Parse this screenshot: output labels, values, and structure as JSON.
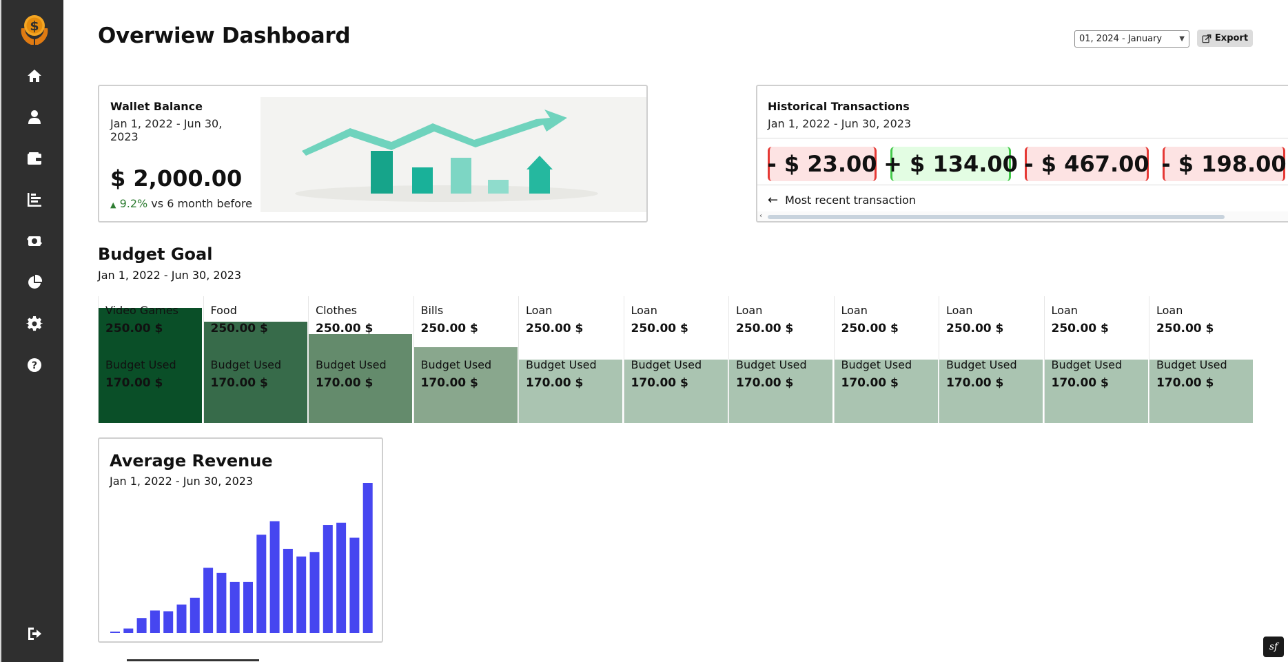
{
  "sidebar": {
    "items": [
      {
        "icon": "home-icon"
      },
      {
        "icon": "user-icon"
      },
      {
        "icon": "wallet-icon"
      },
      {
        "icon": "bar-chart-icon"
      },
      {
        "icon": "money-exchange-icon"
      },
      {
        "icon": "pie-chart-icon"
      },
      {
        "icon": "gear-icon"
      },
      {
        "icon": "help-icon"
      }
    ],
    "logout_icon": "logout-icon"
  },
  "header": {
    "title": "Overwiew Dashboard",
    "month_select": "01, 2024 - January",
    "export_label": "Export"
  },
  "wallet": {
    "title": "Wallet Balance",
    "range": "Jan 1, 2022 - Jun 30, 2023",
    "balance": "$ 2,000.00",
    "delta_pct": "9.2%",
    "delta_text": " vs 6 month before"
  },
  "history": {
    "title": "Historical Transactions",
    "range": "Jan 1, 2022 - Jun 30, 2023",
    "transactions": [
      {
        "label": "- $ 23.00",
        "kind": "neg"
      },
      {
        "label": "+ $ 134.00",
        "kind": "pos"
      },
      {
        "label": "- $ 467.00",
        "kind": "neg"
      },
      {
        "label": "- $ 198.00",
        "kind": "neg"
      },
      {
        "label": "-",
        "kind": "neg"
      }
    ],
    "recent_label": "Most recent transaction"
  },
  "budget": {
    "title": "Budget Goal",
    "range": "Jan 1, 2022 - Jun 30, 2023",
    "used_label": "Budget Used",
    "goals": [
      {
        "category": "Video Games",
        "amount": "250.00 $",
        "used": "170.00 $",
        "level": 0.91,
        "color": "#0a4f28"
      },
      {
        "category": "Food",
        "amount": "250.00 $",
        "used": "170.00 $",
        "level": 0.8,
        "color": "#376b4a"
      },
      {
        "category": "Clothes",
        "amount": "250.00 $",
        "used": "170.00 $",
        "level": 0.7,
        "color": "#648b6c"
      },
      {
        "category": "Bills",
        "amount": "250.00 $",
        "used": "170.00 $",
        "level": 0.6,
        "color": "#89a78d"
      },
      {
        "category": "Loan",
        "amount": "250.00 $",
        "used": "170.00 $",
        "level": 0.5,
        "color": "#aac4b1"
      },
      {
        "category": "Loan",
        "amount": "250.00 $",
        "used": "170.00 $",
        "level": 0.5,
        "color": "#aac4b1"
      },
      {
        "category": "Loan",
        "amount": "250.00 $",
        "used": "170.00 $",
        "level": 0.5,
        "color": "#aac4b1"
      },
      {
        "category": "Loan",
        "amount": "250.00 $",
        "used": "170.00 $",
        "level": 0.5,
        "color": "#aac4b1"
      },
      {
        "category": "Loan",
        "amount": "250.00 $",
        "used": "170.00 $",
        "level": 0.5,
        "color": "#aac4b1"
      },
      {
        "category": "Loan",
        "amount": "250.00 $",
        "used": "170.00 $",
        "level": 0.5,
        "color": "#aac4b1"
      },
      {
        "category": "Loan",
        "amount": "250.00 $",
        "used": "170.00 $",
        "level": 0.5,
        "color": "#aac4b1"
      }
    ]
  },
  "revenue": {
    "title": "Average Revenue",
    "range": "Jan 1, 2022 - Jun 30, 2023",
    "chart_data": {
      "type": "bar",
      "values": [
        2,
        6,
        20,
        30,
        29,
        38,
        47,
        87,
        80,
        68,
        68,
        131,
        149,
        112,
        102,
        108,
        144,
        147,
        127,
        200
      ],
      "ylim": [
        0,
        200
      ],
      "color": "#4646f0",
      "grid": false
    }
  },
  "colors": {
    "sidebar_bg": "#2f2f2f",
    "neg_bg": "#fde3e3",
    "pos_bg": "#e3fde3",
    "accent_bar": "#4646f0"
  }
}
